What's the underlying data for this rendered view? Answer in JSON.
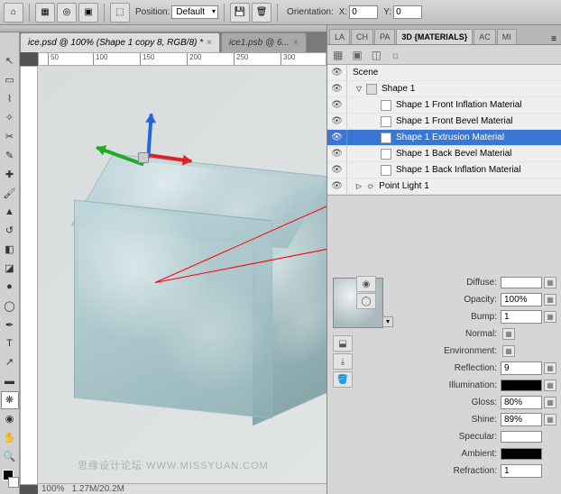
{
  "topbar": {
    "position_label": "Position:",
    "position_value": "Default",
    "orientation_label": "Orientation:",
    "x_label": "X:",
    "x_value": "0",
    "y_label": "Y:",
    "y_value": "0"
  },
  "tabs": [
    {
      "title": "ice.psd @ 100% (Shape 1 copy 8, RGB/8) *",
      "active": true
    },
    {
      "title": "ice1.psb @ 6...",
      "active": false
    }
  ],
  "ruler_ticks": [
    "50",
    "100",
    "150",
    "200",
    "250",
    "300"
  ],
  "panel_tabs": [
    "LA",
    "CH",
    "PA",
    "3D {MATERIALS}",
    "AC",
    "MI"
  ],
  "panel_active": "3D {MATERIALS}",
  "scene": {
    "root": "Scene",
    "shape": "Shape 1",
    "materials": [
      "Shape 1 Front Inflation Material",
      "Shape 1 Front Bevel Material",
      "Shape 1 Extrusion Material",
      "Shape 1 Back Bevel Material",
      "Shape 1 Back Inflation Material"
    ],
    "selected_index": 2,
    "light": "Point Light 1"
  },
  "props": {
    "diffuse_label": "Diffuse:",
    "opacity_label": "Opacity:",
    "opacity": "100%",
    "bump_label": "Bump:",
    "bump": "1",
    "normal_label": "Normal:",
    "environment_label": "Environment:",
    "reflection_label": "Reflection:",
    "reflection": "9",
    "illumination_label": "Illumination:",
    "gloss_label": "Gloss:",
    "gloss": "80%",
    "shine_label": "Shine:",
    "shine": "89%",
    "specular_label": "Specular:",
    "ambient_label": "Ambient:",
    "refraction_label": "Refraction:",
    "refraction": "1"
  },
  "watermark": "思缘设计论坛  WWW.MISSYUAN.COM",
  "status": {
    "zoom": "100%",
    "dim": "1.27M/20.2M"
  }
}
